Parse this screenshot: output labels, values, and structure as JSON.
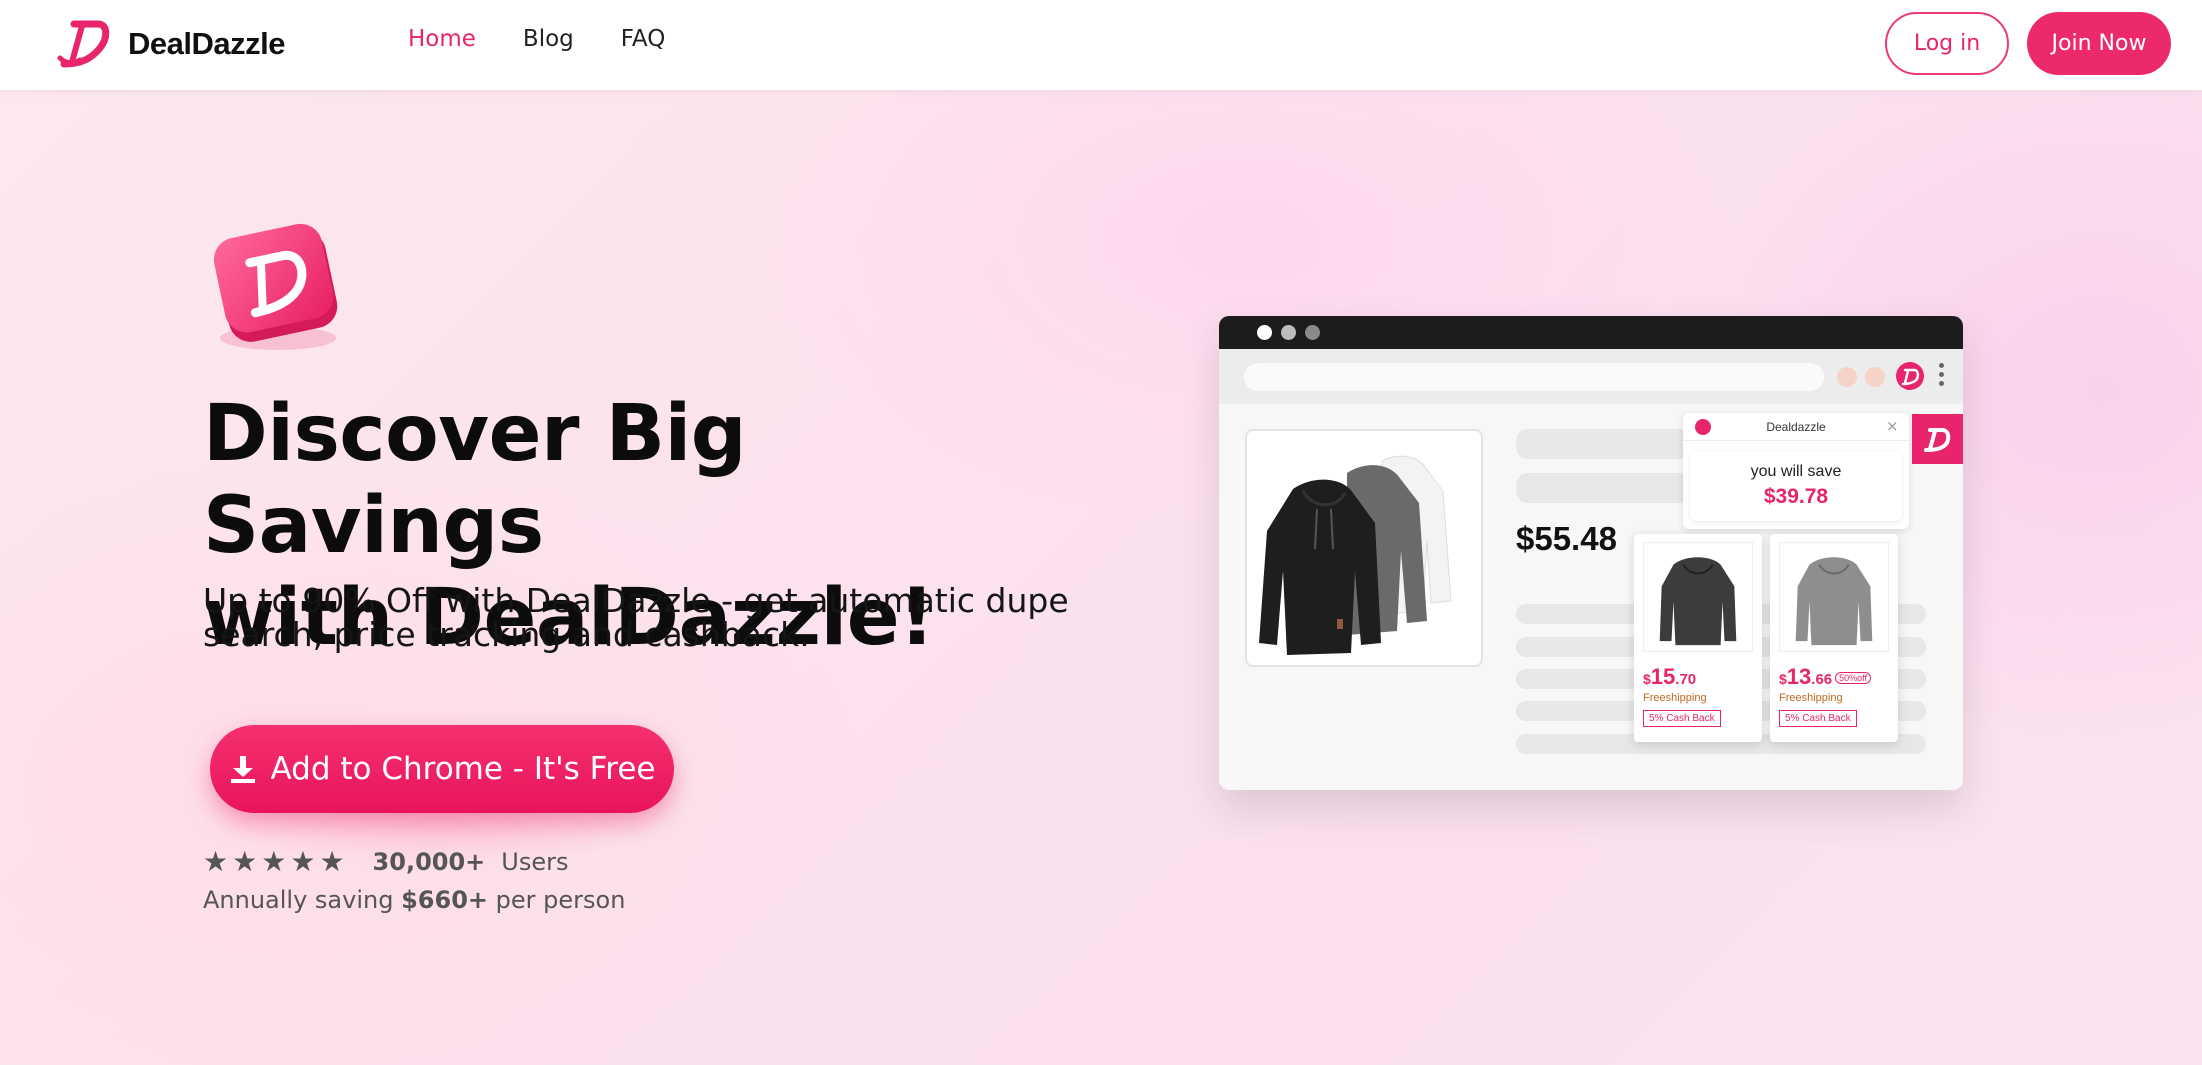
{
  "nav": {
    "logo_text": "DealDazzle",
    "links": [
      "Home",
      "Blog",
      "FAQ"
    ],
    "login_label": "Log in",
    "join_label": "Join Now"
  },
  "hero": {
    "headline_line1": "Discover Big Savings",
    "headline_line2": "with DealDazzle!",
    "subline": "Up to 90% Off with DealDazzle - get automatic dupe search, price tracking and cashback.",
    "cta_label": "Add to Chrome - It's Free",
    "rating_stars": 5,
    "users_count": "30,000+",
    "users_label": "Users",
    "saving_prefix": "Annually saving",
    "saving_amount": "$660+",
    "saving_suffix": "per person"
  },
  "mockup": {
    "main_price": "$55.48",
    "popup_title": "Dealdazzle",
    "popup_close": "×",
    "save_label": "you will save",
    "save_amount": "$39.78",
    "dupes": [
      {
        "currency": "$",
        "whole": "15",
        "cents": ".70",
        "off": "",
        "shipping": "Freeshipping",
        "cashback": "5% Cash Back"
      },
      {
        "currency": "$",
        "whole": "13",
        "cents": ".66",
        "off": "50%off",
        "shipping": "Freeshipping",
        "cashback": "5% Cash Back"
      }
    ]
  },
  "colors": {
    "brand": "#e8256c",
    "text_dark": "#111111",
    "text_muted": "#555555"
  },
  "icons": [
    "logo-d-icon",
    "download-icon",
    "star-icon",
    "close-icon",
    "kebab-menu-icon"
  ]
}
